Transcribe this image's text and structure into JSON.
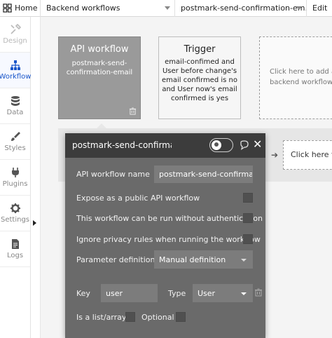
{
  "topbar": {
    "home": "Home",
    "page": "Backend workflows",
    "workflow": "postmark-send-confirmation-em...",
    "edit": "Edit"
  },
  "sidebar": {
    "items": [
      {
        "label": "Design",
        "icon": "design-tools-icon",
        "state": "disabled"
      },
      {
        "label": "Workflow",
        "icon": "workflow-tree-icon",
        "state": "active"
      },
      {
        "label": "Data",
        "icon": "database-icon"
      },
      {
        "label": "Styles",
        "icon": "brush-icon"
      },
      {
        "label": "Plugins",
        "icon": "plug-icon"
      },
      {
        "label": "Settings",
        "icon": "gear-icon"
      },
      {
        "label": "Logs",
        "icon": "document-icon"
      }
    ],
    "accent_color": "#1a56c9"
  },
  "canvas": {
    "api_card": {
      "title": "API workflow",
      "name": "postmark-send-confirmation-email"
    },
    "trigger_card": {
      "title": "Trigger",
      "condition": "email-confimed and User before change's email confirmed is no and User now's email confirmed is yes"
    },
    "add_card": {
      "line1": "Click here to add a",
      "line2": "backend workflow..."
    },
    "step_placeholder": "Click here to"
  },
  "panel": {
    "title": "postmark-send-confirma",
    "name_label": "API workflow name",
    "name_value": "postmark-send-confirmation",
    "expose_label": "Expose as a public API workflow",
    "no_auth_label": "This workflow can be run without authentication",
    "privacy_label": "Ignore privacy rules when running the workflow",
    "param_def_label": "Parameter definition",
    "param_def_value": "Manual definition",
    "key_label": "Key",
    "key_value": "user",
    "type_label": "Type",
    "type_value": "User",
    "is_list_label": "Is a list/array",
    "optional_label": "Optional",
    "colors": {
      "header": "#3c3c3c",
      "body": "#6a6a6a"
    }
  }
}
